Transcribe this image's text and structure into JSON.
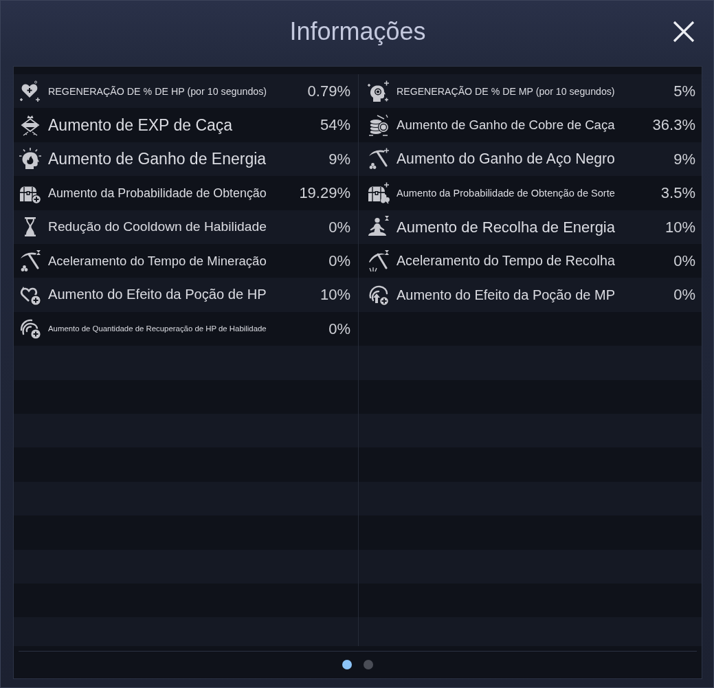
{
  "window": {
    "title": "Informações"
  },
  "columns": [
    {
      "rows": [
        {
          "label": "REGENERAÇÃO DE % DE HP (por 10 segundos)",
          "value": "0.79%"
        },
        {
          "label": "Aumento de EXP de Caça",
          "value": "54%"
        },
        {
          "label": "Aumento de Ganho de Energia",
          "value": "9%"
        },
        {
          "label": "Aumento da Probabilidade de Obtenção",
          "value": "19.29%"
        },
        {
          "label": "Redução do Cooldown de Habilidade",
          "value": "0%"
        },
        {
          "label": "Aceleramento do Tempo de Mineração",
          "value": "0%"
        },
        {
          "label": "Aumento do Efeito da Poção de HP",
          "value": "10%"
        },
        {
          "label": "Aumento de Quantidade de Recuperação de HP de Habilidade",
          "value": "0%"
        }
      ]
    },
    {
      "rows": [
        {
          "label": "REGENERAÇÃO DE % DE MP (por 10 segundos)",
          "value": "5%"
        },
        {
          "label": "Aumento de Ganho de Cobre de Caça",
          "value": "36.3%"
        },
        {
          "label": "Aumento do Ganho de Aço Negro",
          "value": "9%"
        },
        {
          "label": "Aumento da Probabilidade de Obtenção de Sorte",
          "value": "3.5%"
        },
        {
          "label": "Aumento de Recolha de Energia",
          "value": "10%"
        },
        {
          "label": "Aceleramento do Tempo de Recolha",
          "value": "0%"
        },
        {
          "label": "Aumento do Efeito da Poção de MP",
          "value": "0%"
        }
      ]
    }
  ],
  "pager": {
    "pages": [
      {
        "selected": true
      },
      {
        "selected": false
      }
    ]
  }
}
